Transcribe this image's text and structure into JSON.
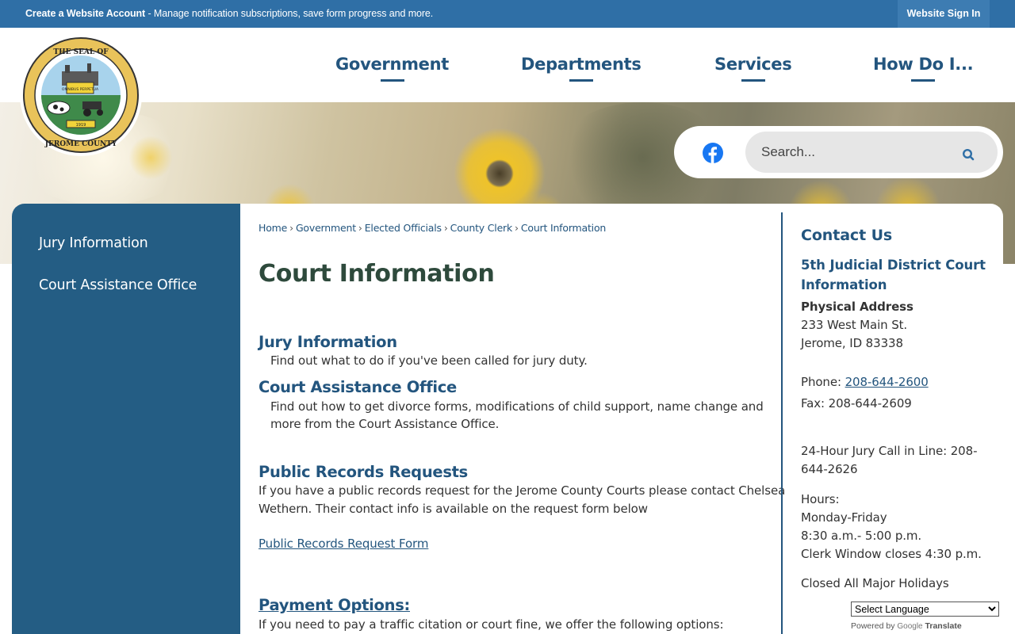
{
  "topbar": {
    "account_bold": "Create a Website Account",
    "account_text": " - Manage notification subscriptions, save form progress and more.",
    "signin": "Website Sign In"
  },
  "nav": {
    "items": [
      "Government",
      "Departments",
      "Services",
      "How Do I..."
    ]
  },
  "seal": {
    "text_top": "THE SEAL OF",
    "text_bottom": "JEROME COUNTY",
    "banner": "OMNIBUS PERPETUA",
    "year": "1919"
  },
  "search": {
    "placeholder": "Search..."
  },
  "sidebar": {
    "items": [
      "Jury Information",
      "Court Assistance Office"
    ]
  },
  "breadcrumb": {
    "items": [
      "Home",
      "Government",
      "Elected Officials",
      "County Clerk",
      "Court Information"
    ],
    "separator": "›"
  },
  "page": {
    "title": "Court Information",
    "sections": [
      {
        "heading": "Jury Information",
        "text": "Find out what to do if you've been called for jury duty."
      },
      {
        "heading": "Court Assistance Office",
        "text_line1": "Find out how to get divorce forms, modifications of child support, name change and",
        "text_line2": "more from the Court Assistance Office."
      }
    ],
    "public_records": {
      "heading": "Public Records Requests",
      "line1": "If you have a public records request for the Jerome County Courts please contact Chelsea",
      "line2": "Wethern. Their contact info is available on the request form below",
      "link": "Public Records Request Form"
    },
    "payment": {
      "heading": "Payment Options:",
      "text": "If you need to pay a traffic citation or court fine, we offer the following options:"
    }
  },
  "contact": {
    "title": "Contact Us",
    "subtitle_line1": "5th Judicial District Court",
    "subtitle_line2": "Information",
    "address_label": "Physical Address",
    "address_line1": "233 West Main St.",
    "address_line2": "Jerome, ID 83338",
    "phone_label": "Phone: ",
    "phone": "208-644-2600",
    "fax": "Fax: 208-644-2609",
    "jury_line1": "24-Hour Jury Call in Line: 208-",
    "jury_line2": "644-2626",
    "hours_label": "Hours:",
    "hours_days": "Monday-Friday",
    "hours_time": "8:30 a.m.- 5:00 p.m.",
    "hours_clerk": "Clerk Window closes 4:30 p.m.",
    "holidays": "Closed All Major Holidays"
  },
  "translate": {
    "select_label": "Select Language",
    "powered_by": "Powered by",
    "google": "Google",
    "translate_word": "Translate"
  },
  "colors": {
    "topbar": "#2f6fa6",
    "nav": "#23557e",
    "sidebar": "#245d84",
    "title": "#2e4a3c"
  }
}
